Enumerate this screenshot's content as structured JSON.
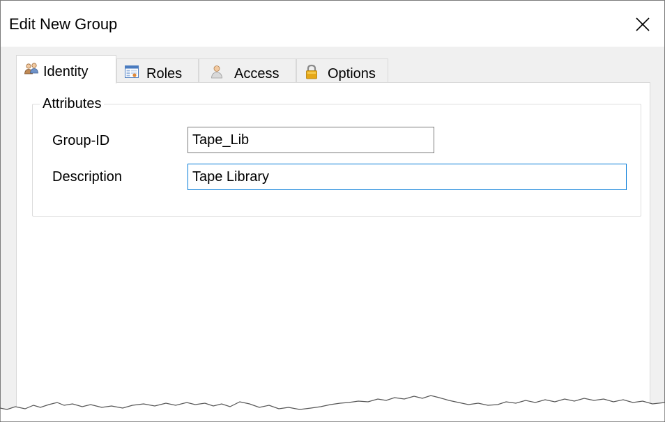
{
  "window": {
    "title": "Edit New Group",
    "close_glyph": "✕"
  },
  "tabs": [
    {
      "label": "Identity",
      "icon": "users-icon",
      "active": true
    },
    {
      "label": "Roles",
      "icon": "roles-window-icon",
      "active": false
    },
    {
      "label": "Access",
      "icon": "person-icon",
      "active": false
    },
    {
      "label": "Options",
      "icon": "lock-icon",
      "active": false
    }
  ],
  "attributes": {
    "legend": "Attributes",
    "group_id": {
      "label": "Group-ID",
      "value": "Tape_Lib"
    },
    "description": {
      "label": "Description",
      "value": "Tape Library"
    }
  },
  "colors": {
    "focus_border": "#0078d7",
    "panel_bg": "#ffffff",
    "client_bg": "#f0f0f0",
    "lock_gold": "#e6a817"
  }
}
